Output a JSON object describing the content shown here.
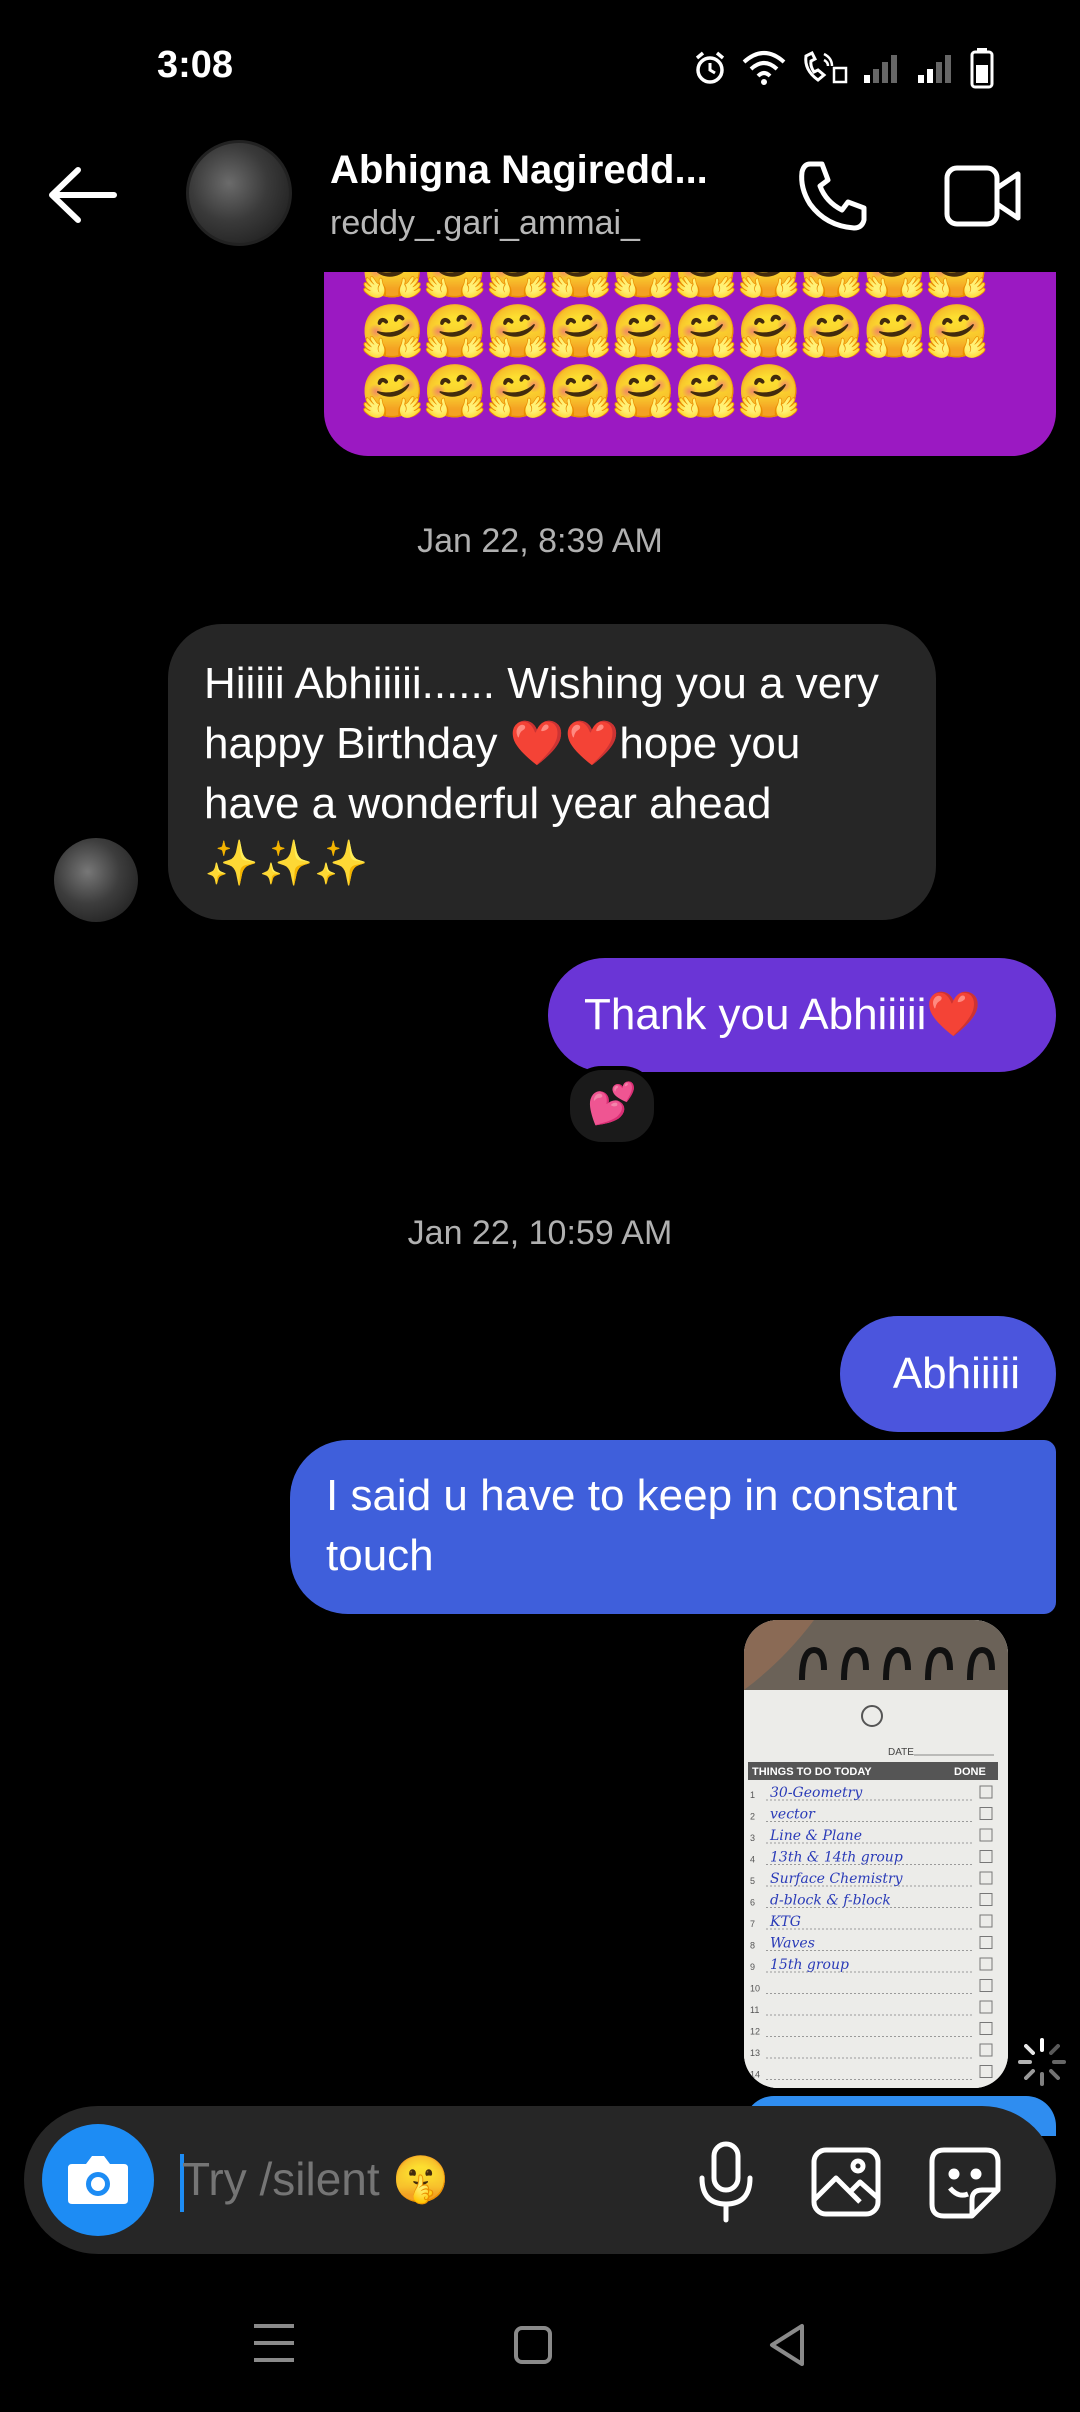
{
  "status_bar": {
    "time": "3:08",
    "icons": [
      "alarm-icon",
      "wifi-icon",
      "volte-call-icon",
      "signal-icon",
      "signal-icon",
      "battery-icon"
    ]
  },
  "header": {
    "name": "Abhigna Nagiredd...",
    "username": "reddy_.gari_ammai_",
    "icons": [
      "back-arrow-icon",
      "phone-icon",
      "video-camera-icon"
    ]
  },
  "messages": {
    "emoji_block": "🤗🤗🤗🤗🤗🤗🤗🤗🤗🤗🤗🤗🤗🤗🤗🤗🤗🤗🤗🤗🤗🤗🤗🤗🤗🤗🤗",
    "timestamp_1": "Jan 22, 8:39 AM",
    "received_1": "Hiiiii Abhiiiii...... Wishing you a very happy Birthday ❤️❤️hope you have a wonderful year ahead ✨✨✨",
    "sent_1": "Thank you Abhiiiii❤️",
    "reaction_1": "💕",
    "timestamp_2": "Jan 22, 10:59 AM",
    "sent_2": "Abhiiiii",
    "sent_3": "I said u have to keep in constant touch",
    "image_note": {
      "date_label": "DATE",
      "header": "THINGS TO DO TODAY",
      "done": "DONE",
      "items": [
        "30-Geometry",
        "vector",
        "Line & Plane",
        "13th & 14th group",
        "Surface Chemistry",
        "d-block & f-block",
        "KTG",
        "Waves",
        "15th group"
      ]
    }
  },
  "composer": {
    "placeholder": "Try /silent 🤫"
  },
  "colors": {
    "emoji_bubble": "#9b19c2",
    "sent_purple": "#6a35d6",
    "sent_blue": "#3f5fdb",
    "received": "#262626",
    "accent": "#1d8cf4"
  }
}
